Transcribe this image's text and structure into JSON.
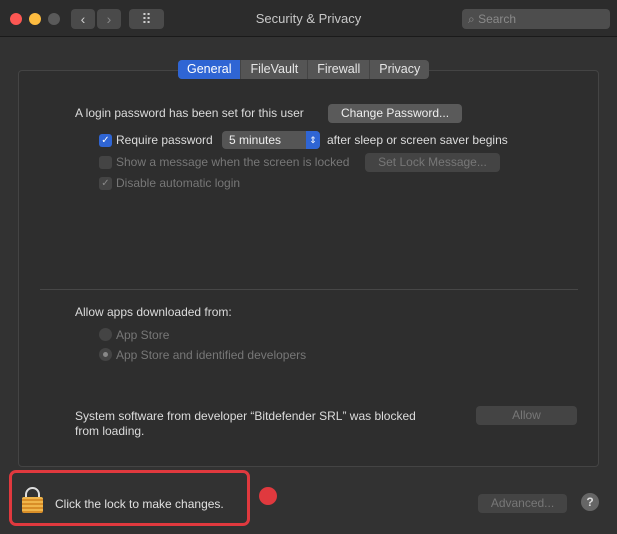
{
  "window": {
    "title": "Security & Privacy",
    "search_placeholder": "Search",
    "back": "‹",
    "forward": "›",
    "grid": "⠿"
  },
  "tabs": [
    {
      "label": "General",
      "active": true
    },
    {
      "label": "FileVault"
    },
    {
      "label": "Firewall"
    },
    {
      "label": "Privacy"
    }
  ],
  "general": {
    "login_text": "A login password has been set for this user",
    "change_password": "Change Password...",
    "require_password": "Require password",
    "require_password_checked": true,
    "delay_value": "5 minutes",
    "after_text": "after sleep or screen saver begins",
    "show_message": "Show a message when the screen is locked",
    "set_lock_message": "Set Lock Message...",
    "disable_auto_login": "Disable automatic login"
  },
  "allow_apps": {
    "label": "Allow apps downloaded from:",
    "options": [
      "App Store",
      "App Store and identified developers"
    ],
    "selected": 1
  },
  "blocked": {
    "line1": "System software from developer “Bitdefender SRL” was blocked",
    "line2": "from loading.",
    "allow": "Allow"
  },
  "footer": {
    "lock_text": "Click the lock to make changes.",
    "advanced": "Advanced...",
    "help": "?"
  },
  "colors": {
    "accent": "#2f65d4",
    "highlight": "#e0393e",
    "lock": "#e8a33a"
  }
}
